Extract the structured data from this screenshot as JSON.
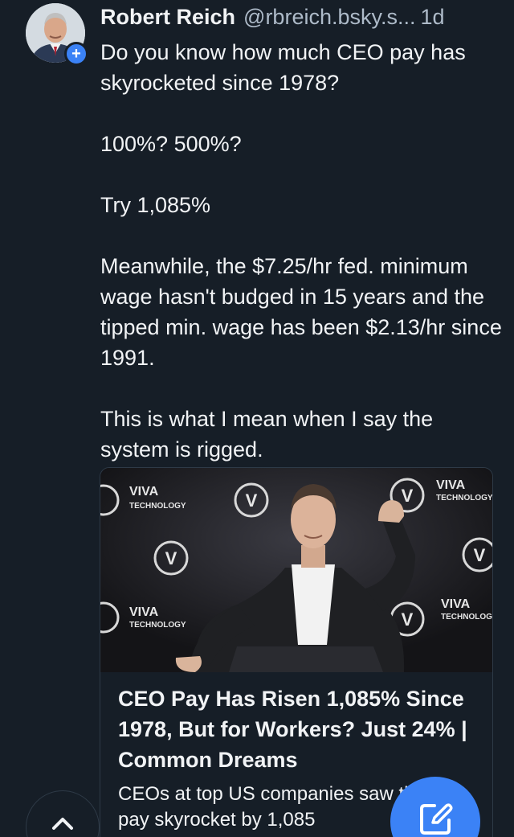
{
  "post": {
    "author_name": "Robert Reich",
    "author_handle": "@rbreich.bsky.s...",
    "time": "1d",
    "follow_glyph": "+",
    "text": [
      "Do you know how much CEO pay has skyrocketed since 1978?",
      "100%? 500%?",
      "Try 1,085%",
      "Meanwhile, the $7.25/hr fed. minimum wage hasn't budged in 15 years and the tipped min. wage has been $2.13/hr since 1991.",
      "This is what I mean when I say the system is rigged."
    ]
  },
  "link_card": {
    "title": "CEO Pay Has Risen 1,085% Since 1978, But for Workers? Just 24% | Common Dreams",
    "description": "CEOs at top US companies saw their pay skyrocket by 1,085",
    "image_backdrop_text": [
      "VIVA",
      "TECHNOLOGY",
      "V"
    ]
  },
  "icons": {
    "scroll_top": "chevron-up-icon",
    "compose": "compose-icon"
  },
  "colors": {
    "background": "#161e27",
    "accent": "#3b82f6",
    "muted_text": "#aebbc9",
    "border": "#2e3a47"
  }
}
